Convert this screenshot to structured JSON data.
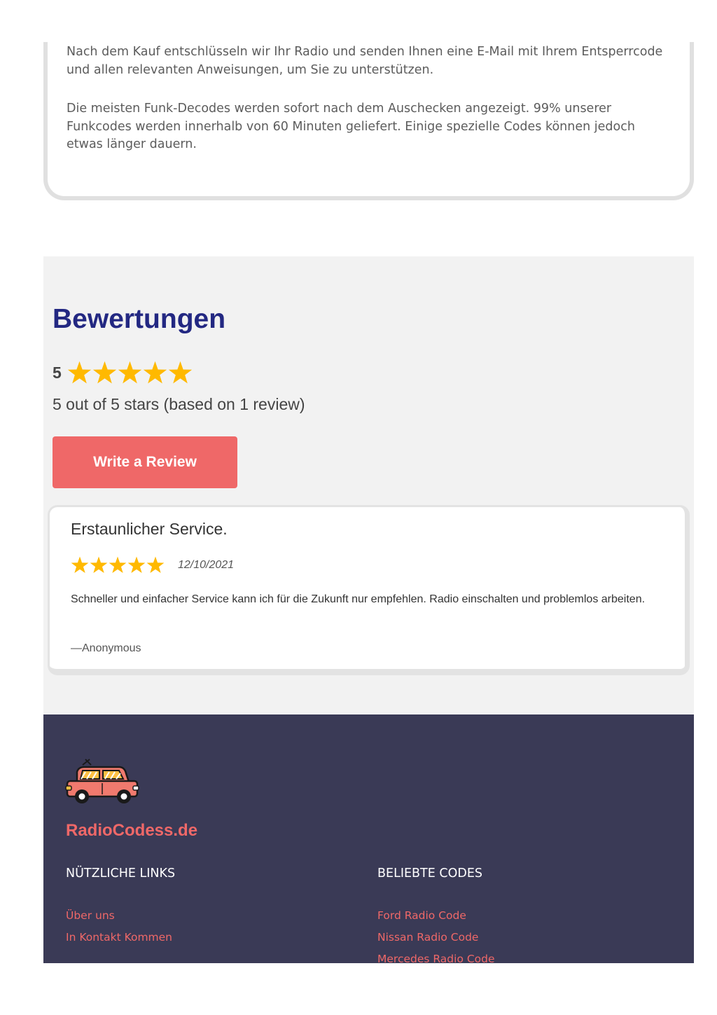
{
  "info": {
    "p1": "Nach dem Kauf entschlüsseln wir Ihr Radio und senden Ihnen eine E-Mail mit Ihrem Entsperrcode und allen relevanten Anweisungen, um Sie zu unterstützen.",
    "p2": "Die meisten Funk-Decodes werden sofort nach dem Auschecken angezeigt. 99% unserer Funkcodes werden innerhalb von 60 Minuten geliefert. Einige spezielle Codes können jedoch etwas länger dauern."
  },
  "reviews": {
    "title": "Bewertungen",
    "average": "5",
    "average_stars": 5,
    "summary": "5 out of 5 stars (based on 1 review)",
    "write_button": "Write a Review",
    "star_color": "#ffb900",
    "items": [
      {
        "title": "Erstaunlicher Service.",
        "stars": 5,
        "date": "12/10/2021",
        "body": "Schneller und einfacher Service kann ich für die Zukunft nur empfehlen. Radio einschalten und problemlos arbeiten.",
        "author": "—Anonymous"
      }
    ]
  },
  "footer": {
    "brand": "RadioCodess.de",
    "columns": [
      {
        "heading": "NÜTZLICHE LINKS",
        "links": [
          "Über uns",
          "In Kontakt Kommen"
        ]
      },
      {
        "heading": "BELIEBTE CODES",
        "links": [
          "Ford Radio Code",
          "Nissan Radio Code",
          "Mercedes Radio Code"
        ]
      }
    ]
  },
  "colors": {
    "accent": "#ef6868",
    "heading": "#232882",
    "footer_bg": "#3a3a56"
  }
}
